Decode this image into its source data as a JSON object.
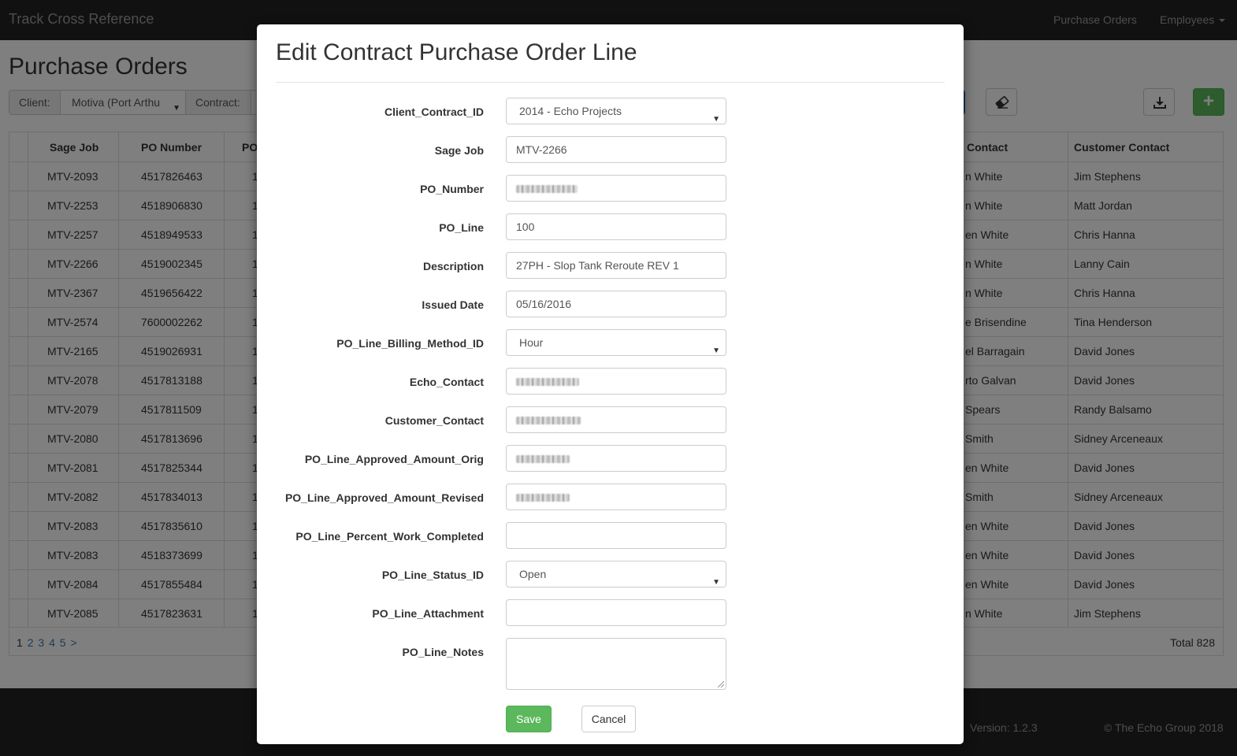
{
  "navbar": {
    "brand": "Track Cross Reference",
    "links": [
      "Purchase Orders",
      "Employees"
    ]
  },
  "page": {
    "title": "Purchase Orders",
    "filters": {
      "client_label": "Client:",
      "client_value": "Motiva (Port Arthu",
      "contract_label": "Contract:"
    }
  },
  "table": {
    "headers": [
      "Sage Job",
      "PO Number",
      "PO",
      "Contact",
      "Customer Contact"
    ],
    "rows": [
      [
        "MTV-2093",
        "4517826463",
        "1",
        "n White",
        "Jim Stephens"
      ],
      [
        "MTV-2253",
        "4518906830",
        "1",
        "n White",
        "Matt Jordan"
      ],
      [
        "MTV-2257",
        "4518949533",
        "1",
        "en White",
        "Chris Hanna"
      ],
      [
        "MTV-2266",
        "4519002345",
        "1",
        "n White",
        "Lanny Cain"
      ],
      [
        "MTV-2367",
        "4519656422",
        "1",
        "n White",
        "Chris Hanna"
      ],
      [
        "MTV-2574",
        "7600002262",
        "1",
        "e Brisendine",
        "Tina Henderson"
      ],
      [
        "MTV-2165",
        "4519026931",
        "1",
        "el Barragain",
        "David Jones"
      ],
      [
        "MTV-2078",
        "4517813188",
        "1",
        "rto Galvan",
        "David Jones"
      ],
      [
        "MTV-2079",
        "4517811509",
        "1",
        "Spears",
        "Randy Balsamo"
      ],
      [
        "MTV-2080",
        "4517813696",
        "1",
        "Smith",
        "Sidney Arceneaux"
      ],
      [
        "MTV-2081",
        "4517825344",
        "1",
        "en White",
        "David Jones"
      ],
      [
        "MTV-2082",
        "4517834013",
        "1",
        "Smith",
        "Sidney Arceneaux"
      ],
      [
        "MTV-2083",
        "4517835610",
        "1",
        "en White",
        "David Jones"
      ],
      [
        "MTV-2083",
        "4518373699",
        "1",
        "en White",
        "David Jones"
      ],
      [
        "MTV-2084",
        "4517855484",
        "1",
        "en White",
        "David Jones"
      ],
      [
        "MTV-2085",
        "4517823631",
        "1",
        "n White",
        "Jim Stephens"
      ]
    ],
    "pager": [
      "1",
      "2",
      "3",
      "4",
      "5",
      ">"
    ],
    "total": "Total 828"
  },
  "footer": {
    "version": "Version: 1.2.3",
    "copyright": "© The Echo Group 2018"
  },
  "modal": {
    "title": "Edit Contract Purchase Order Line",
    "fields": [
      {
        "label": "Client_Contract_ID",
        "value": "2014 - Echo Projects",
        "kind": "select"
      },
      {
        "label": "Sage Job",
        "value": "MTV-2266",
        "kind": "input"
      },
      {
        "label": "PO_Number",
        "value": "",
        "kind": "redacted"
      },
      {
        "label": "PO_Line",
        "value": "100",
        "kind": "input"
      },
      {
        "label": "Description",
        "value": "27PH - Slop Tank Reroute REV 1",
        "kind": "input"
      },
      {
        "label": "Issued Date",
        "value": "05/16/2016",
        "kind": "input"
      },
      {
        "label": "PO_Line_Billing_Method_ID",
        "value": "Hour",
        "kind": "select"
      },
      {
        "label": "Echo_Contact",
        "value": "",
        "kind": "redacted"
      },
      {
        "label": "Customer_Contact",
        "value": "",
        "kind": "redacted"
      },
      {
        "label": "PO_Line_Approved_Amount_Orig",
        "value": "",
        "kind": "redacted"
      },
      {
        "label": "PO_Line_Approved_Amount_Revised",
        "value": "",
        "kind": "redacted"
      },
      {
        "label": "PO_Line_Percent_Work_Completed",
        "value": "",
        "kind": "input"
      },
      {
        "label": "PO_Line_Status_ID",
        "value": "Open",
        "kind": "select"
      },
      {
        "label": "PO_Line_Attachment",
        "value": "",
        "kind": "input"
      }
    ],
    "notes_label": "PO_Line_Notes",
    "save_label": "Save",
    "cancel_label": "Cancel"
  },
  "icons": {
    "eraser": "eraser-icon",
    "download": "download-icon",
    "add": "plus-icon"
  },
  "colors": {
    "navbar": "#222222",
    "success": "#5cb85c",
    "link": "#337ab7"
  }
}
